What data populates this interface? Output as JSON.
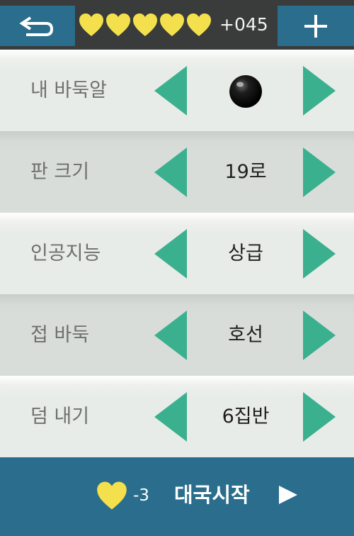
{
  "header": {
    "hearts_count": 5,
    "hearts_value": "+045"
  },
  "settings": [
    {
      "label": "내 바둑알",
      "value": "",
      "icon": "black-stone-icon"
    },
    {
      "label": "판 크기",
      "value": "19로"
    },
    {
      "label": "인공지능",
      "value": "상급"
    },
    {
      "label": "접 바둑",
      "value": "호선"
    },
    {
      "label": "덤 내기",
      "value": "6집반"
    }
  ],
  "start": {
    "cost": "-3",
    "label": "대국시작"
  },
  "colors": {
    "accent": "#2a6d8c",
    "arrow": "#3bb08f",
    "heart": "#f4e04d",
    "topbar": "#3a3c3b"
  }
}
